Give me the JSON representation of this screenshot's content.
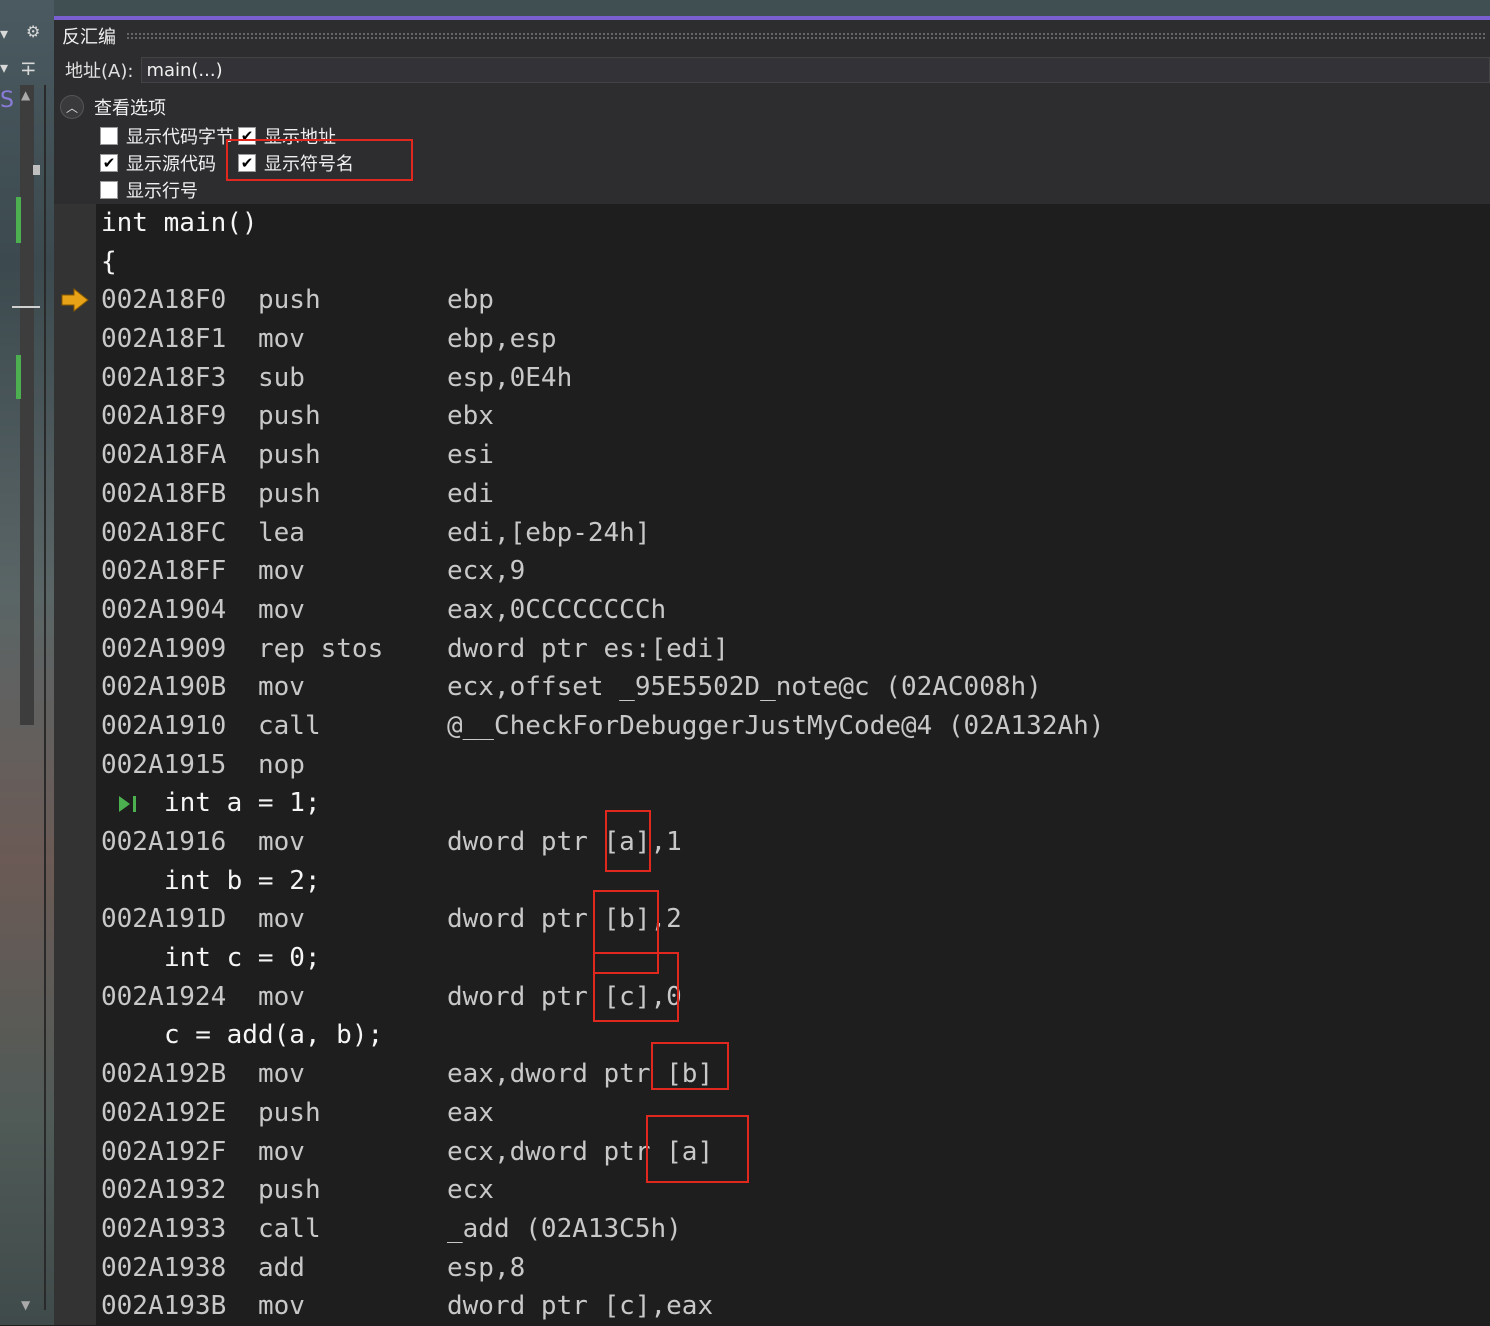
{
  "window": {
    "title": "反汇编",
    "address_label": "地址(A):",
    "address_value": "main(...)"
  },
  "view_options": {
    "header": "查看选项",
    "checkboxes": [
      {
        "label": "显示代码字节",
        "checked": false
      },
      {
        "label": "显示地址",
        "checked": true
      },
      {
        "label": "显示源代码",
        "checked": true
      },
      {
        "label": "显示符号名",
        "checked": true,
        "highlighted": true
      },
      {
        "label": "显示行号",
        "checked": false
      }
    ]
  },
  "left_strip": {
    "glyph": "S",
    "icons": [
      "dropdown-arrow-icon",
      "gear-icon",
      "split-icon",
      "scroll-up-icon",
      "scroll-down-icon"
    ]
  },
  "code": {
    "current_instruction_marker": "yellow-arrow",
    "lines": [
      {
        "kind": "src",
        "text": "int main()"
      },
      {
        "kind": "src",
        "text": "{"
      },
      {
        "kind": "asm",
        "addr": "002A18F0",
        "op": "push",
        "args": "ebp",
        "current": true
      },
      {
        "kind": "asm",
        "addr": "002A18F1",
        "op": "mov",
        "args": "ebp,esp"
      },
      {
        "kind": "asm",
        "addr": "002A18F3",
        "op": "sub",
        "args": "esp,0E4h"
      },
      {
        "kind": "asm",
        "addr": "002A18F9",
        "op": "push",
        "args": "ebx"
      },
      {
        "kind": "asm",
        "addr": "002A18FA",
        "op": "push",
        "args": "esi"
      },
      {
        "kind": "asm",
        "addr": "002A18FB",
        "op": "push",
        "args": "edi"
      },
      {
        "kind": "asm",
        "addr": "002A18FC",
        "op": "lea",
        "args": "edi,[ebp-24h]"
      },
      {
        "kind": "asm",
        "addr": "002A18FF",
        "op": "mov",
        "args": "ecx,9"
      },
      {
        "kind": "asm",
        "addr": "002A1904",
        "op": "mov",
        "args": "eax,0CCCCCCCCh"
      },
      {
        "kind": "asm",
        "addr": "002A1909",
        "op": "rep stos",
        "args": "dword ptr es:[edi]"
      },
      {
        "kind": "asm",
        "addr": "002A190B",
        "op": "mov",
        "args": "ecx,offset _95E5502D_note@c (02AC008h)"
      },
      {
        "kind": "asm",
        "addr": "002A1910",
        "op": "call",
        "args": "@__CheckForDebuggerJustMyCode@4 (02A132Ah)"
      },
      {
        "kind": "asm",
        "addr": "002A1915",
        "op": "nop",
        "args": ""
      },
      {
        "kind": "src",
        "text": "int a = 1;",
        "indent": true,
        "step_marker": true
      },
      {
        "kind": "asm",
        "addr": "002A1916",
        "op": "mov",
        "args": "dword ptr [a],1"
      },
      {
        "kind": "src",
        "text": "int b = 2;",
        "indent": true
      },
      {
        "kind": "asm",
        "addr": "002A191D",
        "op": "mov",
        "args": "dword ptr [b],2"
      },
      {
        "kind": "src",
        "text": "int c = 0;",
        "indent": true
      },
      {
        "kind": "asm",
        "addr": "002A1924",
        "op": "mov",
        "args": "dword ptr [c],0"
      },
      {
        "kind": "src",
        "text": "c = add(a, b);",
        "indent": true
      },
      {
        "kind": "asm",
        "addr": "002A192B",
        "op": "mov",
        "args": "eax,dword ptr [b]"
      },
      {
        "kind": "asm",
        "addr": "002A192E",
        "op": "push",
        "args": "eax"
      },
      {
        "kind": "asm",
        "addr": "002A192F",
        "op": "mov",
        "args": "ecx,dword ptr [a]"
      },
      {
        "kind": "asm",
        "addr": "002A1932",
        "op": "push",
        "args": "ecx"
      },
      {
        "kind": "asm",
        "addr": "002A1933",
        "op": "call",
        "args": "_add (02A13C5h)"
      },
      {
        "kind": "asm",
        "addr": "002A1938",
        "op": "add",
        "args": "esp,8"
      },
      {
        "kind": "asm",
        "addr": "002A193B",
        "op": "mov",
        "args": "dword ptr [c],eax"
      }
    ]
  },
  "colors": {
    "highlight_box": "#e0281e",
    "accent": "#7a5fd0",
    "current_arrow": "#e8a317",
    "step_marker": "#4caf50"
  }
}
